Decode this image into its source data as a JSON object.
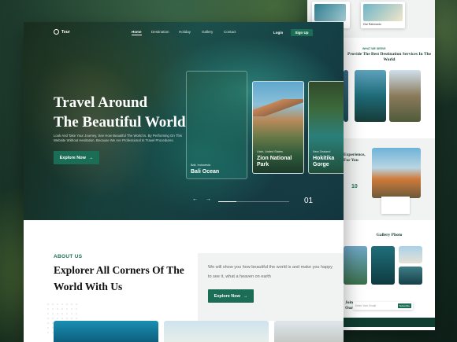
{
  "nav": {
    "logo": "Tour",
    "links": [
      "Home",
      "Destination",
      "Holiday",
      "Gallery",
      "Contact"
    ],
    "login": "Login",
    "signup": "Sign Up"
  },
  "hero": {
    "title_line1": "Travel Around",
    "title_line2": "The Beautiful World",
    "description": "Look And Take Your Journey, See How Beautiful The World Is. By Performing On This Website Without Hesitation, Because We Are Professional In Travel Procedures.",
    "explore_label": "Explore Now",
    "slide_number": "01",
    "progress": 0.25,
    "cards": [
      {
        "sub": "Bali, Indonesia",
        "name": "Bali Ocean"
      },
      {
        "sub": "Utah, United States",
        "name": "Zion National Park"
      },
      {
        "sub": "New Zealand",
        "name": "Hokitika Gorge"
      }
    ]
  },
  "about": {
    "label": "ABOUT US",
    "title": "Explorer All Corners Of The World With Us",
    "text": "We will show you how beautiful the world is and make you happy to see it, what a heaven on earth",
    "explore_label": "Explore Now"
  },
  "back_page": {
    "review_name": "Dwi Rahmanto",
    "services_label": "WHAT WE SERVE",
    "services_title": "Provide The Best Destination Services In The World",
    "experience_title": "Experience, For You",
    "experience_num": "10",
    "gallery_title": "Gallery Photo",
    "newsletter_title": "Join Our",
    "email_placeholder": "Enter Your Email",
    "subscribe_label": "Subscribe"
  },
  "colors": {
    "accent": "#1b6e55",
    "dark_green": "#0f3d2f"
  }
}
